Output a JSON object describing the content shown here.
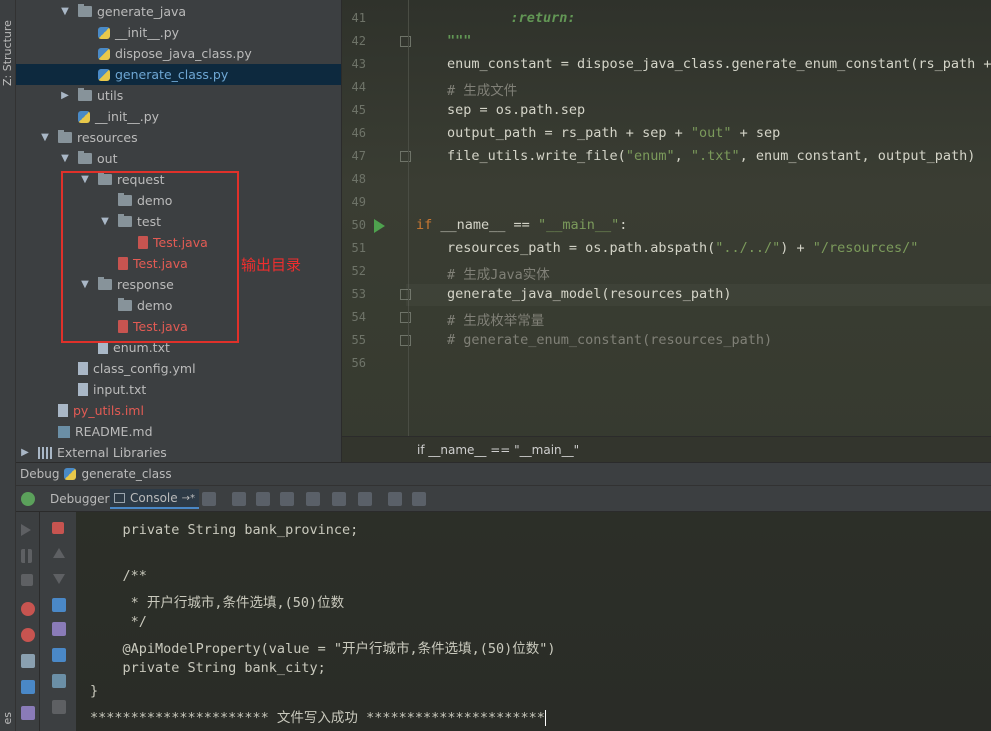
{
  "side_strip": {
    "structure_label": "Z: Structure",
    "bottom_label": "es"
  },
  "project_tree": [
    {
      "indent": 2,
      "arrow": "▼",
      "icon": "folder",
      "label": "generate_java",
      "style": ""
    },
    {
      "indent": 3,
      "arrow": "",
      "icon": "pyfile",
      "label": "__init__.py",
      "style": ""
    },
    {
      "indent": 3,
      "arrow": "",
      "icon": "pyfile",
      "label": "dispose_java_class.py",
      "style": ""
    },
    {
      "indent": 3,
      "arrow": "",
      "icon": "pyfile",
      "label": "generate_class.py",
      "style": "selected"
    },
    {
      "indent": 2,
      "arrow": "▶",
      "icon": "folder",
      "label": "utils",
      "style": ""
    },
    {
      "indent": 2,
      "arrow": "",
      "icon": "pyfile",
      "label": "__init__.py",
      "style": ""
    },
    {
      "indent": 1,
      "arrow": "▼",
      "icon": "folder",
      "label": "resources",
      "style": ""
    },
    {
      "indent": 2,
      "arrow": "▼",
      "icon": "folder",
      "label": "out",
      "style": ""
    },
    {
      "indent": 3,
      "arrow": "▼",
      "icon": "folder",
      "label": "request",
      "style": ""
    },
    {
      "indent": 4,
      "arrow": "",
      "icon": "folder",
      "label": "demo",
      "style": ""
    },
    {
      "indent": 4,
      "arrow": "▼",
      "icon": "folder",
      "label": "test",
      "style": ""
    },
    {
      "indent": 5,
      "arrow": "",
      "icon": "javafile",
      "label": "Test.java",
      "style": "red"
    },
    {
      "indent": 4,
      "arrow": "",
      "icon": "javafile",
      "label": "Test.java",
      "style": "red"
    },
    {
      "indent": 3,
      "arrow": "▼",
      "icon": "folder",
      "label": "response",
      "style": ""
    },
    {
      "indent": 4,
      "arrow": "",
      "icon": "folder",
      "label": "demo",
      "style": ""
    },
    {
      "indent": 4,
      "arrow": "",
      "icon": "javafile",
      "label": "Test.java",
      "style": "red"
    },
    {
      "indent": 3,
      "arrow": "",
      "icon": "txtfile",
      "label": "enum.txt",
      "style": ""
    },
    {
      "indent": 2,
      "arrow": "",
      "icon": "txtfile",
      "label": "class_config.yml",
      "style": ""
    },
    {
      "indent": 2,
      "arrow": "",
      "icon": "txtfile",
      "label": "input.txt",
      "style": ""
    },
    {
      "indent": 1,
      "arrow": "",
      "icon": "txtfile",
      "label": "py_utils.iml",
      "style": "red"
    },
    {
      "indent": 1,
      "arrow": "",
      "icon": "mdfile",
      "label": "README.md",
      "style": ""
    },
    {
      "indent": 0,
      "arrow": "▶",
      "icon": "libs",
      "label": "External Libraries",
      "style": ""
    }
  ],
  "annotation": {
    "output_dir_label": "输出目录"
  },
  "editor": {
    "lines": [
      {
        "n": "41",
        "segs": [
          {
            "t": "    ",
            "c": ""
          },
          {
            "t": ":return:",
            "c": "doc"
          }
        ]
      },
      {
        "n": "42",
        "segs": [
          {
            "t": "\"\"\"",
            "c": "doc"
          }
        ]
      },
      {
        "n": "43",
        "segs": [
          {
            "t": "enum_constant = dispose_java_class.generate_enum_constant(rs_path + ",
            "c": ""
          }
        ]
      },
      {
        "n": "44",
        "segs": [
          {
            "t": "# 生成文件",
            "c": "cmt"
          }
        ]
      },
      {
        "n": "45",
        "segs": [
          {
            "t": "sep = os.path.sep",
            "c": ""
          }
        ]
      },
      {
        "n": "46",
        "segs": [
          {
            "t": "output_path = rs_path + sep + ",
            "c": ""
          },
          {
            "t": "\"out\"",
            "c": "str"
          },
          {
            "t": " + sep",
            "c": ""
          }
        ]
      },
      {
        "n": "47",
        "segs": [
          {
            "t": "file_utils.write_file(",
            "c": ""
          },
          {
            "t": "\"enum\"",
            "c": "str"
          },
          {
            "t": ", ",
            "c": ""
          },
          {
            "t": "\".txt\"",
            "c": "str"
          },
          {
            "t": ", enum_constant, output_path)",
            "c": ""
          }
        ]
      },
      {
        "n": "48",
        "segs": []
      },
      {
        "n": "49",
        "segs": []
      },
      {
        "n": "50",
        "segs": [
          {
            "t": "if",
            "c": "kw"
          },
          {
            "t": " __name__ == ",
            "c": ""
          },
          {
            "t": "\"__main__\"",
            "c": "str"
          },
          {
            "t": ":",
            "c": ""
          }
        ]
      },
      {
        "n": "51",
        "segs": [
          {
            "t": "resources_path = os.path.abspath(",
            "c": ""
          },
          {
            "t": "\"../../\"",
            "c": "str"
          },
          {
            "t": ") + ",
            "c": ""
          },
          {
            "t": "\"/resources/\"",
            "c": "str"
          }
        ]
      },
      {
        "n": "52",
        "segs": [
          {
            "t": "# 生成Java实体",
            "c": "cmt"
          }
        ]
      },
      {
        "n": "53",
        "segs": [
          {
            "t": "generate_java_model(resources_path)",
            "c": ""
          }
        ]
      },
      {
        "n": "54",
        "segs": [
          {
            "t": "# 生成枚举常量",
            "c": "cmt"
          }
        ]
      },
      {
        "n": "55",
        "segs": [
          {
            "t": "# generate_enum_constant(resources_path)",
            "c": "cmt"
          }
        ]
      },
      {
        "n": "56",
        "segs": []
      }
    ],
    "breadcrumb": "if __name__ == \"__main__\""
  },
  "debug": {
    "title": "Debug",
    "config_name": "generate_class",
    "tabs": {
      "debugger": "Debugger",
      "console": "Console",
      "console_suffix": "→*"
    }
  },
  "console": {
    "lines": [
      "    private String bank_province;",
      "",
      "    /**",
      "     * 开户行城市,条件选填,(50)位数",
      "     */",
      "    @ApiModelProperty(value = \"开户行城市,条件选填,(50)位数\")",
      "    private String bank_city;",
      "}",
      "********************** 文件写入成功 **********************"
    ]
  }
}
